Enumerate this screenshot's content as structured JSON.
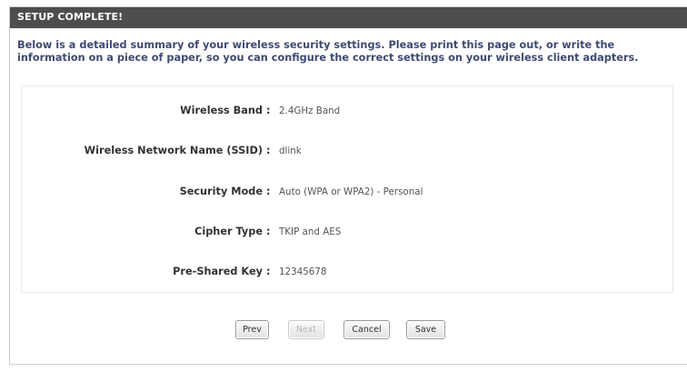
{
  "header": {
    "title": "SETUP COMPLETE!"
  },
  "intro": {
    "text": "Below is a detailed summary of your wireless security settings. Please print this page out, or write the information on a piece of paper, so you can configure the correct settings on your wireless client adapters."
  },
  "summary": {
    "separator": ":",
    "rows": [
      {
        "label": "Wireless Band",
        "value": "2.4GHz Band"
      },
      {
        "label": "Wireless Network Name (SSID)",
        "value": "dlink"
      },
      {
        "label": "Security Mode",
        "value": "Auto (WPA or WPA2) - Personal"
      },
      {
        "label": "Cipher Type",
        "value": "TKIP and AES"
      },
      {
        "label": "Pre-Shared Key",
        "value": "12345678"
      }
    ]
  },
  "buttons": {
    "prev": "Prev",
    "next": "Next",
    "cancel": "Cancel",
    "save": "Save"
  },
  "colors": {
    "header_bg": "#4d4d4d",
    "intro_text": "#3f4a73"
  }
}
